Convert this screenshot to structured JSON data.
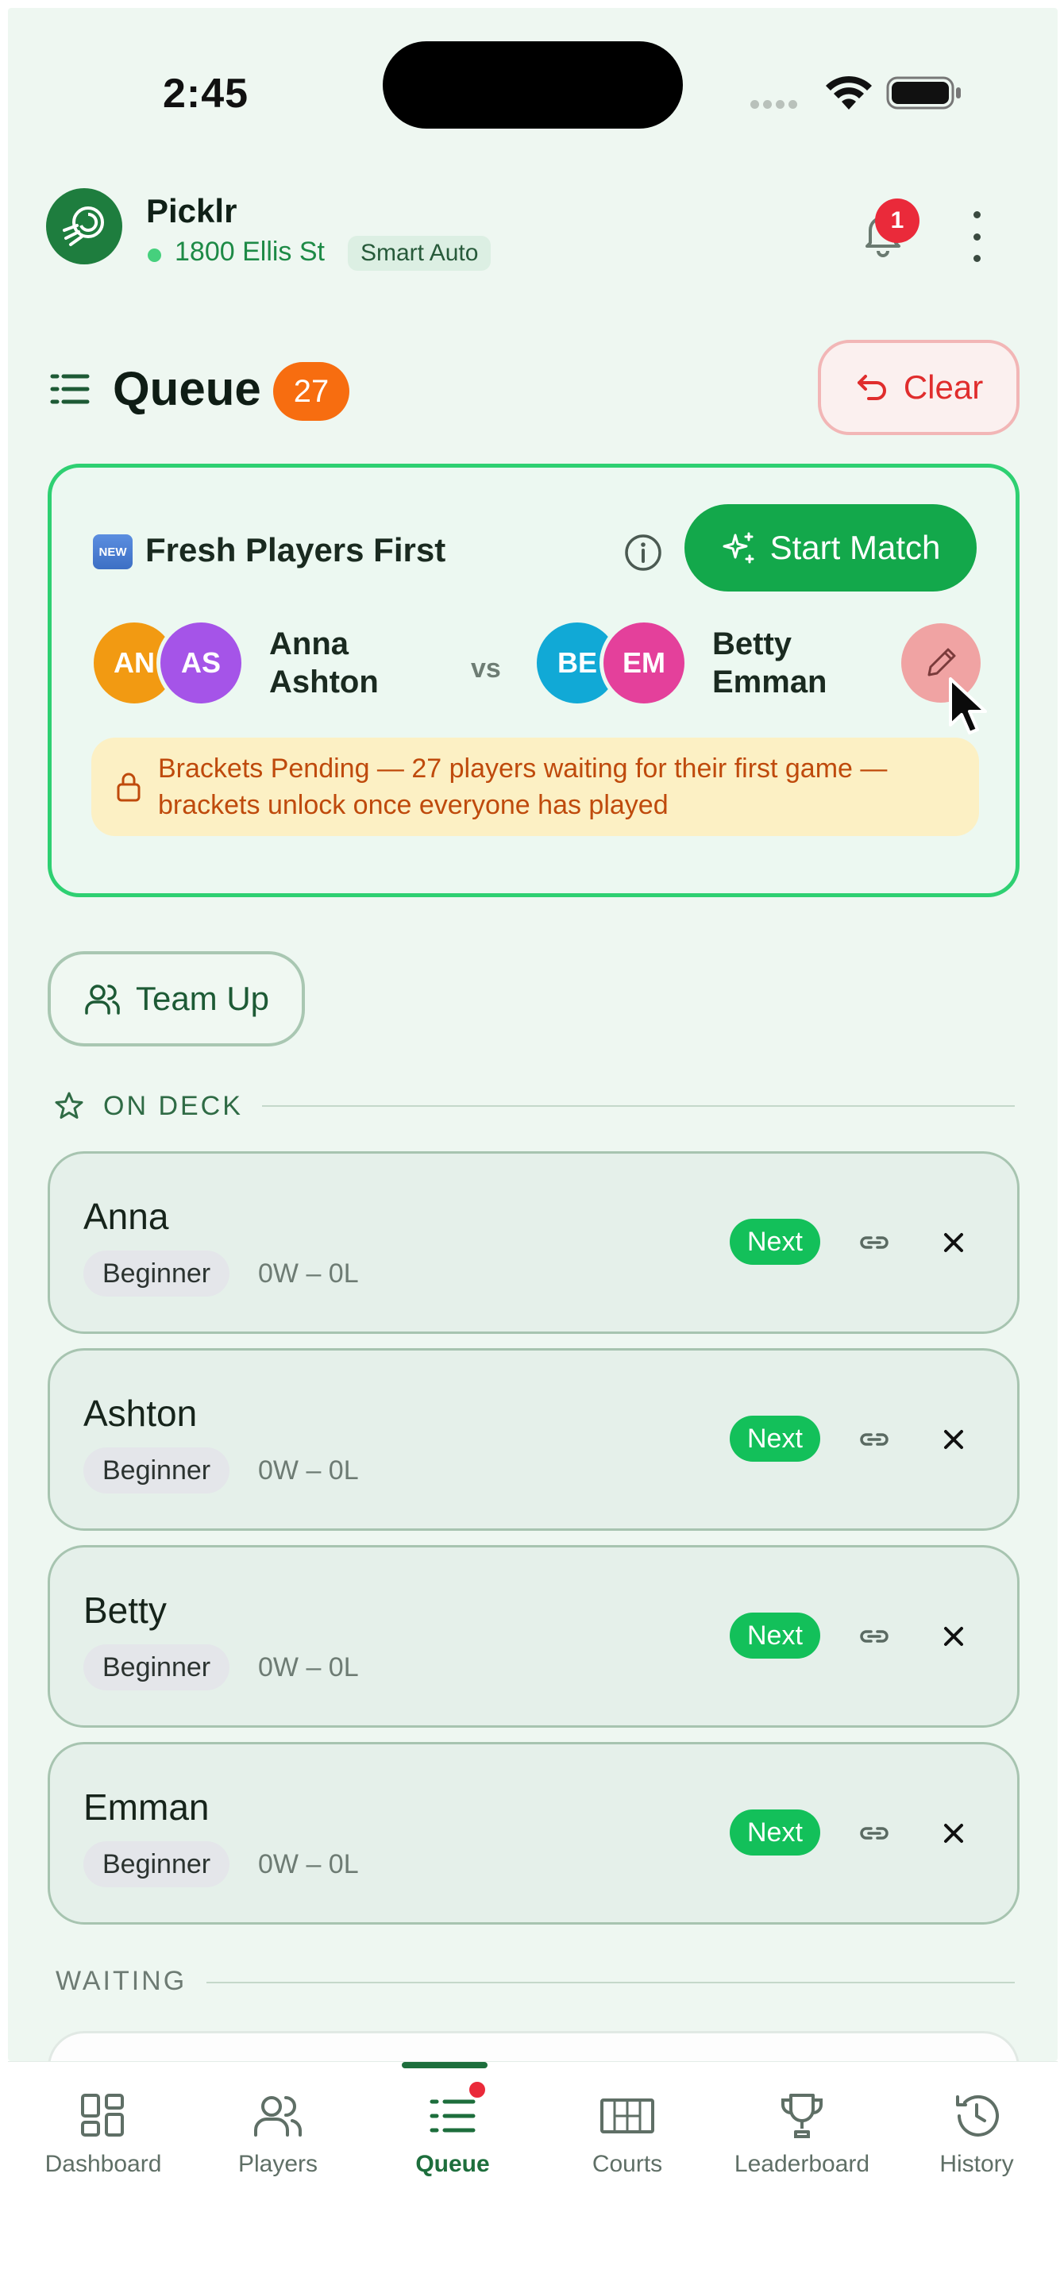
{
  "status_bar": {
    "time": "2:45"
  },
  "header": {
    "app_name": "Picklr",
    "location": "1800 Ellis St",
    "mode_badge": "Smart Auto",
    "notification_count": "1"
  },
  "queue": {
    "title": "Queue",
    "count": "27",
    "clear_label": "Clear"
  },
  "match_card": {
    "new_badge": "NEW",
    "mode_title": "Fresh Players First",
    "start_label": "Start Match",
    "team_a": {
      "initials": [
        "AN",
        "AS"
      ],
      "names": [
        "Anna",
        "Ashton"
      ],
      "colors": [
        "#f29a12",
        "#a554e8"
      ]
    },
    "vs_label": "vs",
    "team_b": {
      "initials": [
        "BE",
        "EM"
      ],
      "names": [
        "Betty",
        "Emman"
      ],
      "colors": [
        "#11a9d6",
        "#e4409b"
      ]
    },
    "pending_text": "Brackets Pending — 27 players waiting for their first game — brackets unlock once everyone has played"
  },
  "team_up_label": "Team Up",
  "on_deck": {
    "label": "ON DECK",
    "players": [
      {
        "name": "Anna",
        "level": "Beginner",
        "record": "0W – 0L",
        "badge": "Next"
      },
      {
        "name": "Ashton",
        "level": "Beginner",
        "record": "0W – 0L",
        "badge": "Next"
      },
      {
        "name": "Betty",
        "level": "Beginner",
        "record": "0W – 0L",
        "badge": "Next"
      },
      {
        "name": "Emman",
        "level": "Beginner",
        "record": "0W – 0L",
        "badge": "Next"
      }
    ]
  },
  "waiting": {
    "label": "WAITING"
  },
  "nav": {
    "items": [
      {
        "label": "Dashboard",
        "icon": "dashboard-icon"
      },
      {
        "label": "Players",
        "icon": "players-icon"
      },
      {
        "label": "Queue",
        "icon": "queue-icon",
        "active": true
      },
      {
        "label": "Courts",
        "icon": "courts-icon"
      },
      {
        "label": "Leaderboard",
        "icon": "trophy-icon"
      },
      {
        "label": "History",
        "icon": "history-icon"
      }
    ]
  },
  "colors": {
    "brand_green": "#13a84b",
    "accent_orange": "#f76d10",
    "danger_red": "#e02d2d",
    "card_border_green": "#2ed072"
  }
}
